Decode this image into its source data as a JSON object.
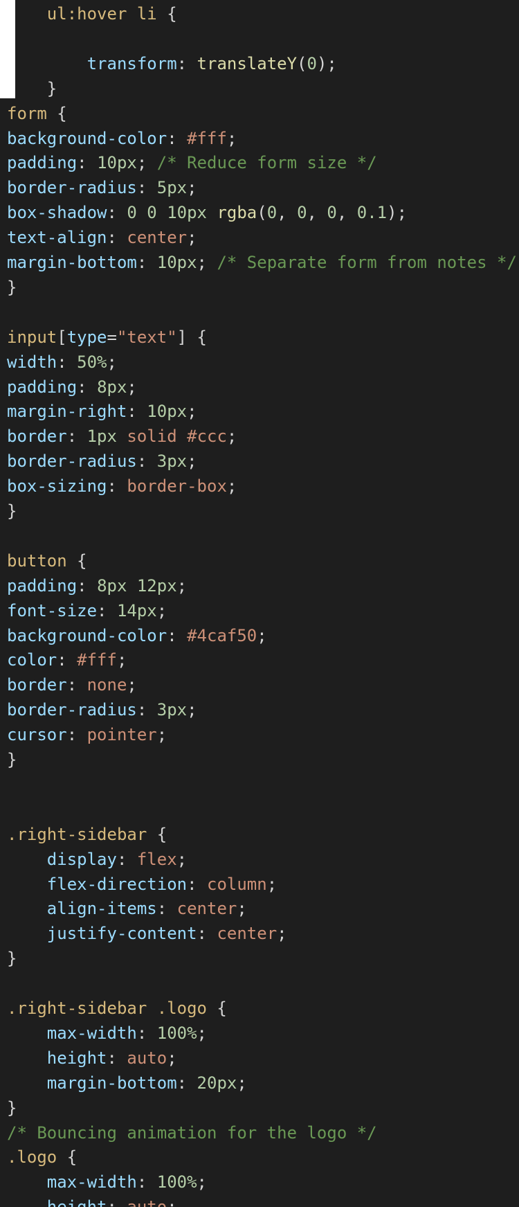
{
  "editor": {
    "language": "css",
    "colors": {
      "background": "#1e1e1e",
      "selector": "#d7ba7d",
      "property": "#9cdcfe",
      "string_value": "#ce9178",
      "number": "#b5cea8",
      "comment": "#6a9955",
      "punctuation": "#d4d4d4",
      "function": "#dcdcaa"
    },
    "lines": [
      {
        "indent": "    ",
        "tokens": [
          {
            "t": "sel",
            "v": "ul:hover li"
          },
          {
            "t": "pn",
            "v": " {"
          }
        ]
      },
      {
        "indent": "",
        "tokens": []
      },
      {
        "indent": "        ",
        "tokens": [
          {
            "t": "prop",
            "v": "transform"
          },
          {
            "t": "pn",
            "v": ": "
          },
          {
            "t": "fn",
            "v": "translateY"
          },
          {
            "t": "pn",
            "v": "("
          },
          {
            "t": "num",
            "v": "0"
          },
          {
            "t": "pn",
            "v": ");"
          }
        ]
      },
      {
        "indent": "    ",
        "tokens": [
          {
            "t": "pn",
            "v": "}"
          }
        ]
      },
      {
        "indent": "",
        "tokens": [
          {
            "t": "sel",
            "v": "form"
          },
          {
            "t": "pn",
            "v": " {"
          }
        ]
      },
      {
        "indent": "",
        "tokens": [
          {
            "t": "prop",
            "v": "background-color"
          },
          {
            "t": "pn",
            "v": ": "
          },
          {
            "t": "val",
            "v": "#fff"
          },
          {
            "t": "pn",
            "v": ";"
          }
        ]
      },
      {
        "indent": "",
        "tokens": [
          {
            "t": "prop",
            "v": "padding"
          },
          {
            "t": "pn",
            "v": ": "
          },
          {
            "t": "num",
            "v": "10px"
          },
          {
            "t": "pn",
            "v": "; "
          },
          {
            "t": "cm",
            "v": "/* Reduce form size */"
          }
        ]
      },
      {
        "indent": "",
        "tokens": [
          {
            "t": "prop",
            "v": "border-radius"
          },
          {
            "t": "pn",
            "v": ": "
          },
          {
            "t": "num",
            "v": "5px"
          },
          {
            "t": "pn",
            "v": ";"
          }
        ]
      },
      {
        "indent": "",
        "tokens": [
          {
            "t": "prop",
            "v": "box-shadow"
          },
          {
            "t": "pn",
            "v": ": "
          },
          {
            "t": "num",
            "v": "0 0 10px"
          },
          {
            "t": "pn",
            "v": " "
          },
          {
            "t": "fn",
            "v": "rgba"
          },
          {
            "t": "pn",
            "v": "("
          },
          {
            "t": "num",
            "v": "0"
          },
          {
            "t": "pn",
            "v": ", "
          },
          {
            "t": "num",
            "v": "0"
          },
          {
            "t": "pn",
            "v": ", "
          },
          {
            "t": "num",
            "v": "0"
          },
          {
            "t": "pn",
            "v": ", "
          },
          {
            "t": "num",
            "v": "0.1"
          },
          {
            "t": "pn",
            "v": ");"
          }
        ]
      },
      {
        "indent": "",
        "tokens": [
          {
            "t": "prop",
            "v": "text-align"
          },
          {
            "t": "pn",
            "v": ": "
          },
          {
            "t": "val",
            "v": "center"
          },
          {
            "t": "pn",
            "v": ";"
          }
        ]
      },
      {
        "indent": "",
        "tokens": [
          {
            "t": "prop",
            "v": "margin-bottom"
          },
          {
            "t": "pn",
            "v": ": "
          },
          {
            "t": "num",
            "v": "10px"
          },
          {
            "t": "pn",
            "v": "; "
          },
          {
            "t": "cm",
            "v": "/* Separate form from notes */"
          }
        ]
      },
      {
        "indent": "",
        "tokens": [
          {
            "t": "pn",
            "v": "}"
          }
        ]
      },
      {
        "indent": "",
        "tokens": []
      },
      {
        "indent": "",
        "tokens": [
          {
            "t": "sel",
            "v": "input"
          },
          {
            "t": "pn",
            "v": "["
          },
          {
            "t": "prop",
            "v": "type"
          },
          {
            "t": "pn",
            "v": "="
          },
          {
            "t": "val",
            "v": "\"text\""
          },
          {
            "t": "pn",
            "v": "] {"
          }
        ]
      },
      {
        "indent": "",
        "tokens": [
          {
            "t": "prop",
            "v": "width"
          },
          {
            "t": "pn",
            "v": ": "
          },
          {
            "t": "num",
            "v": "50%"
          },
          {
            "t": "pn",
            "v": ";"
          }
        ]
      },
      {
        "indent": "",
        "tokens": [
          {
            "t": "prop",
            "v": "padding"
          },
          {
            "t": "pn",
            "v": ": "
          },
          {
            "t": "num",
            "v": "8px"
          },
          {
            "t": "pn",
            "v": ";"
          }
        ]
      },
      {
        "indent": "",
        "tokens": [
          {
            "t": "prop",
            "v": "margin-right"
          },
          {
            "t": "pn",
            "v": ": "
          },
          {
            "t": "num",
            "v": "10px"
          },
          {
            "t": "pn",
            "v": ";"
          }
        ]
      },
      {
        "indent": "",
        "tokens": [
          {
            "t": "prop",
            "v": "border"
          },
          {
            "t": "pn",
            "v": ": "
          },
          {
            "t": "num",
            "v": "1px"
          },
          {
            "t": "pn",
            "v": " "
          },
          {
            "t": "val",
            "v": "solid #ccc"
          },
          {
            "t": "pn",
            "v": ";"
          }
        ]
      },
      {
        "indent": "",
        "tokens": [
          {
            "t": "prop",
            "v": "border-radius"
          },
          {
            "t": "pn",
            "v": ": "
          },
          {
            "t": "num",
            "v": "3px"
          },
          {
            "t": "pn",
            "v": ";"
          }
        ]
      },
      {
        "indent": "",
        "tokens": [
          {
            "t": "prop",
            "v": "box-sizing"
          },
          {
            "t": "pn",
            "v": ": "
          },
          {
            "t": "val",
            "v": "border-box"
          },
          {
            "t": "pn",
            "v": ";"
          }
        ]
      },
      {
        "indent": "",
        "tokens": [
          {
            "t": "pn",
            "v": "}"
          }
        ]
      },
      {
        "indent": "",
        "tokens": []
      },
      {
        "indent": "",
        "tokens": [
          {
            "t": "sel",
            "v": "button"
          },
          {
            "t": "pn",
            "v": " {"
          }
        ]
      },
      {
        "indent": "",
        "tokens": [
          {
            "t": "prop",
            "v": "padding"
          },
          {
            "t": "pn",
            "v": ": "
          },
          {
            "t": "num",
            "v": "8px 12px"
          },
          {
            "t": "pn",
            "v": ";"
          }
        ]
      },
      {
        "indent": "",
        "tokens": [
          {
            "t": "prop",
            "v": "font-size"
          },
          {
            "t": "pn",
            "v": ": "
          },
          {
            "t": "num",
            "v": "14px"
          },
          {
            "t": "pn",
            "v": ";"
          }
        ]
      },
      {
        "indent": "",
        "tokens": [
          {
            "t": "prop",
            "v": "background-color"
          },
          {
            "t": "pn",
            "v": ": "
          },
          {
            "t": "val",
            "v": "#4caf50"
          },
          {
            "t": "pn",
            "v": ";"
          }
        ]
      },
      {
        "indent": "",
        "tokens": [
          {
            "t": "prop",
            "v": "color"
          },
          {
            "t": "pn",
            "v": ": "
          },
          {
            "t": "val",
            "v": "#fff"
          },
          {
            "t": "pn",
            "v": ";"
          }
        ]
      },
      {
        "indent": "",
        "tokens": [
          {
            "t": "prop",
            "v": "border"
          },
          {
            "t": "pn",
            "v": ": "
          },
          {
            "t": "val",
            "v": "none"
          },
          {
            "t": "pn",
            "v": ";"
          }
        ]
      },
      {
        "indent": "",
        "tokens": [
          {
            "t": "prop",
            "v": "border-radius"
          },
          {
            "t": "pn",
            "v": ": "
          },
          {
            "t": "num",
            "v": "3px"
          },
          {
            "t": "pn",
            "v": ";"
          }
        ]
      },
      {
        "indent": "",
        "tokens": [
          {
            "t": "prop",
            "v": "cursor"
          },
          {
            "t": "pn",
            "v": ": "
          },
          {
            "t": "val",
            "v": "pointer"
          },
          {
            "t": "pn",
            "v": ";"
          }
        ]
      },
      {
        "indent": "",
        "tokens": [
          {
            "t": "pn",
            "v": "}"
          }
        ]
      },
      {
        "indent": "",
        "tokens": []
      },
      {
        "indent": "",
        "tokens": []
      },
      {
        "indent": "",
        "tokens": [
          {
            "t": "sel",
            "v": ".right-sidebar"
          },
          {
            "t": "pn",
            "v": " {"
          }
        ]
      },
      {
        "indent": "    ",
        "tokens": [
          {
            "t": "prop",
            "v": "display"
          },
          {
            "t": "pn",
            "v": ": "
          },
          {
            "t": "val",
            "v": "flex"
          },
          {
            "t": "pn",
            "v": ";"
          }
        ]
      },
      {
        "indent": "    ",
        "tokens": [
          {
            "t": "prop",
            "v": "flex-direction"
          },
          {
            "t": "pn",
            "v": ": "
          },
          {
            "t": "val",
            "v": "column"
          },
          {
            "t": "pn",
            "v": ";"
          }
        ]
      },
      {
        "indent": "    ",
        "tokens": [
          {
            "t": "prop",
            "v": "align-items"
          },
          {
            "t": "pn",
            "v": ": "
          },
          {
            "t": "val",
            "v": "center"
          },
          {
            "t": "pn",
            "v": ";"
          }
        ]
      },
      {
        "indent": "    ",
        "tokens": [
          {
            "t": "prop",
            "v": "justify-content"
          },
          {
            "t": "pn",
            "v": ": "
          },
          {
            "t": "val",
            "v": "center"
          },
          {
            "t": "pn",
            "v": ";"
          }
        ]
      },
      {
        "indent": "",
        "tokens": [
          {
            "t": "pn",
            "v": "}"
          }
        ]
      },
      {
        "indent": "",
        "tokens": []
      },
      {
        "indent": "",
        "tokens": [
          {
            "t": "sel",
            "v": ".right-sidebar .logo"
          },
          {
            "t": "pn",
            "v": " {"
          }
        ]
      },
      {
        "indent": "    ",
        "tokens": [
          {
            "t": "prop",
            "v": "max-width"
          },
          {
            "t": "pn",
            "v": ": "
          },
          {
            "t": "num",
            "v": "100%"
          },
          {
            "t": "pn",
            "v": ";"
          }
        ]
      },
      {
        "indent": "    ",
        "tokens": [
          {
            "t": "prop",
            "v": "height"
          },
          {
            "t": "pn",
            "v": ": "
          },
          {
            "t": "val",
            "v": "auto"
          },
          {
            "t": "pn",
            "v": ";"
          }
        ]
      },
      {
        "indent": "    ",
        "tokens": [
          {
            "t": "prop",
            "v": "margin-bottom"
          },
          {
            "t": "pn",
            "v": ": "
          },
          {
            "t": "num",
            "v": "20px"
          },
          {
            "t": "pn",
            "v": ";"
          }
        ]
      },
      {
        "indent": "",
        "tokens": [
          {
            "t": "pn",
            "v": "}"
          }
        ]
      },
      {
        "indent": "",
        "tokens": [
          {
            "t": "cm",
            "v": "/* Bouncing animation for the logo */"
          }
        ]
      },
      {
        "indent": "",
        "tokens": [
          {
            "t": "sel",
            "v": ".logo"
          },
          {
            "t": "pn",
            "v": " {"
          }
        ]
      },
      {
        "indent": "    ",
        "tokens": [
          {
            "t": "prop",
            "v": "max-width"
          },
          {
            "t": "pn",
            "v": ": "
          },
          {
            "t": "num",
            "v": "100%"
          },
          {
            "t": "pn",
            "v": ";"
          }
        ]
      },
      {
        "indent": "    ",
        "tokens": [
          {
            "t": "prop",
            "v": "height"
          },
          {
            "t": "pn",
            "v": ": "
          },
          {
            "t": "val",
            "v": "auto"
          },
          {
            "t": "pn",
            "v": ";"
          }
        ]
      }
    ]
  }
}
